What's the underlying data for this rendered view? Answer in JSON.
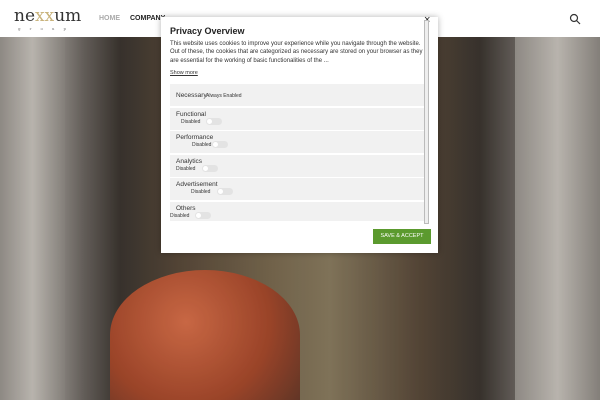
{
  "header": {
    "logo_text": "nexxum",
    "logo_sub": "group",
    "nav": [
      {
        "label": "HOME"
      },
      {
        "label": "COMPANY"
      }
    ]
  },
  "modal": {
    "title": "Privacy Overview",
    "description": "This website uses cookies to improve your experience while you navigate through the website. Out of these, the cookies that are categorized as necessary are stored on your browser as they are essential for the working of basic functionalities of the ...",
    "show_more": "Show more",
    "close": "×",
    "categories": [
      {
        "label": "Necessary",
        "status": "Always Enabled"
      },
      {
        "label": "Functional",
        "status": "Disabled"
      },
      {
        "label": "Performance",
        "status": "Disabled"
      },
      {
        "label": "Analytics",
        "status": "Disabled"
      },
      {
        "label": "Advertisement",
        "status": "Disabled"
      },
      {
        "label": "Others",
        "status": "Disabled"
      }
    ],
    "save_label": "SAVE & ACCEPT"
  },
  "colors": {
    "accent": "#5b9a2e"
  }
}
